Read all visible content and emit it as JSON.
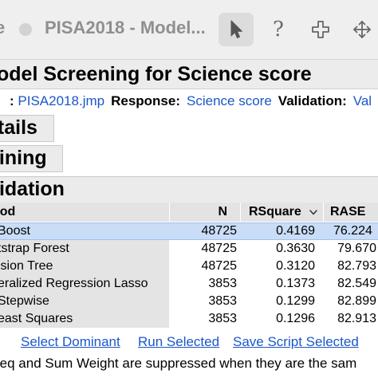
{
  "window": {
    "title": "PISA2018 - Model...",
    "left_glyph": "e",
    "toolbar": {
      "help_glyph": "?"
    }
  },
  "report": {
    "title": "odel Screening for Science score",
    "info": {
      "data_label": ":",
      "data_value": "PISA2018.jmp",
      "response_label": "Response:",
      "response_value": "Science score",
      "validation_label": "Validation:",
      "validation_value": "Val"
    }
  },
  "sections": {
    "details": "etails",
    "training": "aining",
    "validation": "lidation"
  },
  "table": {
    "headers": {
      "method": "hod",
      "n": "N",
      "rsquare": "RSquare",
      "rase": "RASE"
    },
    "rows": [
      {
        "method": "Boost",
        "n": "48725",
        "rsquare": "0.4169",
        "rase": "76.224"
      },
      {
        "method": "tstrap Forest",
        "n": "48725",
        "rsquare": "0.3630",
        "rase": "79.670"
      },
      {
        "method": "ision Tree",
        "n": "48725",
        "rsquare": "0.3120",
        "rase": "82.793"
      },
      {
        "method": "eralized Regression Lasso",
        "n": "3853",
        "rsquare": "0.1373",
        "rase": "82.549"
      },
      {
        "method": "Stepwise",
        "n": "3853",
        "rsquare": "0.1299",
        "rase": "82.899"
      },
      {
        "method": "east Squares",
        "n": "3853",
        "rsquare": "0.1296",
        "rase": "82.913"
      }
    ]
  },
  "actions": {
    "select_dominant": "Select Dominant",
    "run_selected": "Run Selected",
    "save_script_selected": "Save Script Selected"
  },
  "footnote": "req and Sum Weight are suppressed when they are the sam",
  "colors": {
    "link": "#1a57c9",
    "selected_row": "#c9ddf7",
    "title_text": "#8f8f8f"
  }
}
